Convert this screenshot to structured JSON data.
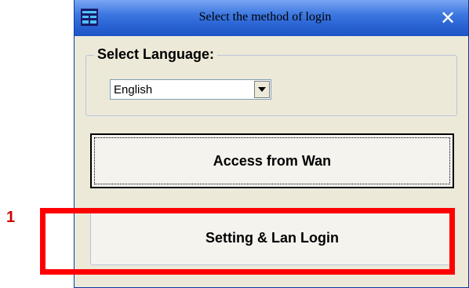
{
  "annotation": {
    "number": "1"
  },
  "window": {
    "title": "Select the method of login",
    "close_glyph": "✕"
  },
  "language": {
    "group_label": "Select Language:",
    "selected": "English"
  },
  "buttons": {
    "access_wan": "Access from Wan",
    "lan_login": "Setting & Lan Login"
  },
  "colors": {
    "titlebar": "#2a63d4",
    "highlight": "#ff0000",
    "annotation_text": "#cc0000",
    "window_bg": "#ece9d8"
  },
  "icons": {
    "app": "app-logo-icon",
    "close": "close-icon",
    "dropdown": "chevron-down-icon"
  }
}
